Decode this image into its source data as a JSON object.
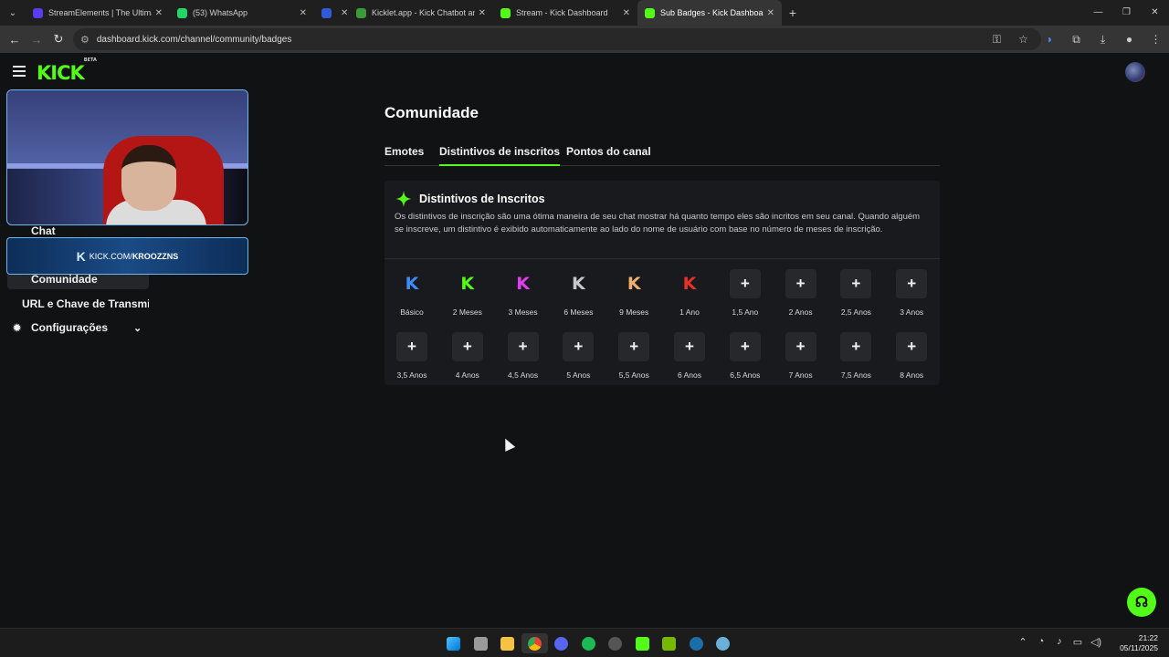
{
  "browser": {
    "tabs": [
      {
        "title": "StreamElements | The Ultimate",
        "color": "#5a3df0"
      },
      {
        "title": "(53) WhatsApp",
        "color": "#25d366"
      },
      {
        "title": "",
        "color": "#2f5bd6"
      },
      {
        "title": "Kicklet.app - Kick Chatbot and",
        "color": "#3a9a3a"
      },
      {
        "title": "Stream - Kick Dashboard",
        "color": "#53fc18"
      },
      {
        "title": "Sub Badges - Kick Dashboard",
        "color": "#53fc18",
        "active": true
      }
    ],
    "url": "dashboard.kick.com/channel/community/badges"
  },
  "header": {
    "logo": "KICK",
    "logo_tag": "BETA"
  },
  "sidebar": {
    "items": [
      {
        "label": "Chat"
      },
      {
        "label": "Comunidade"
      },
      {
        "label": "URL e Chave de Transmissã"
      },
      {
        "label": "Configurações"
      }
    ]
  },
  "overlay": {
    "banner_prefix": "KICK.COM/",
    "banner_channel": "KROOZZNS"
  },
  "main": {
    "title": "Comunidade",
    "tabs": [
      "Emotes",
      "Distintivos de inscritos",
      "Pontos do canal"
    ],
    "panel": {
      "title": "Distintivos de Inscritos",
      "description": "Os distintivos de inscrição são uma ótima maneira de seu chat mostrar há quanto tempo eles são incritos em seu canal. Quando alguém se inscreve, um distintivo é exibido automaticamente ao lado do nome de usuário com base no número de meses de inscrição."
    },
    "badges": [
      {
        "label": "Básico",
        "color": "#3b8cff",
        "set": true
      },
      {
        "label": "2 Meses",
        "color": "#53fc18",
        "set": true
      },
      {
        "label": "3 Meses",
        "color": "#e23cf0",
        "set": true
      },
      {
        "label": "6 Meses",
        "color": "#c8c8c8",
        "set": true
      },
      {
        "label": "9 Meses",
        "color": "#f0b070",
        "set": true
      },
      {
        "label": "1 Ano",
        "color": "#e8302a",
        "set": true
      },
      {
        "label": "1,5 Ano",
        "set": false
      },
      {
        "label": "2 Anos",
        "set": false
      },
      {
        "label": "2,5 Anos",
        "set": false
      },
      {
        "label": "3 Anos",
        "set": false
      },
      {
        "label": "3,5 Anos",
        "set": false
      },
      {
        "label": "4 Anos",
        "set": false
      },
      {
        "label": "4,5 Anos",
        "set": false
      },
      {
        "label": "5 Anos",
        "set": false
      },
      {
        "label": "5,5 Anos",
        "set": false
      },
      {
        "label": "6 Anos",
        "set": false
      },
      {
        "label": "6,5 Anos",
        "set": false
      },
      {
        "label": "7 Anos",
        "set": false
      },
      {
        "label": "7,5 Anos",
        "set": false
      },
      {
        "label": "8 Anos",
        "set": false
      }
    ]
  },
  "taskbar": {
    "time": "21:22",
    "date": "05/11/2025"
  },
  "colors": {
    "accent": "#53fc18",
    "background": "#111214",
    "panel": "#191a1d"
  }
}
